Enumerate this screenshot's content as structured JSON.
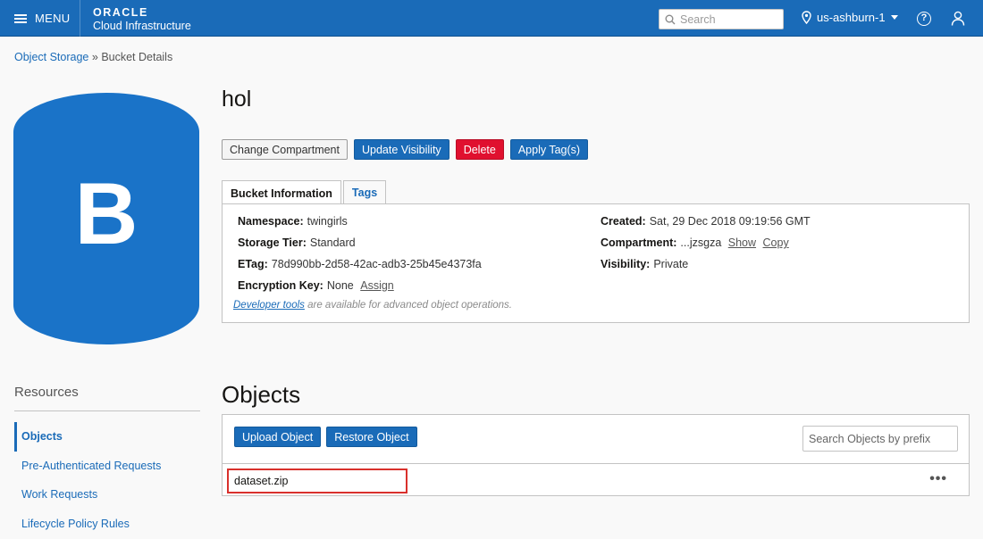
{
  "topbar": {
    "menu_label": "MENU",
    "brand": "ORACLE",
    "brand_sub": "Cloud Infrastructure",
    "search_placeholder": "Search",
    "region": "us-ashburn-1",
    "help_symbol": "?"
  },
  "breadcrumb": {
    "root": "Object Storage",
    "separator": "»",
    "current": "Bucket Details"
  },
  "bucket": {
    "icon_letter": "B",
    "name": "hol",
    "actions": [
      "Change Compartment",
      "Update Visibility",
      "Delete",
      "Apply Tag(s)"
    ]
  },
  "tabs": [
    "Bucket Information",
    "Tags"
  ],
  "info": {
    "namespace": {
      "label": "Namespace:",
      "value": "twingirls"
    },
    "storage_tier": {
      "label": "Storage Tier:",
      "value": "Standard"
    },
    "etag": {
      "label": "ETag:",
      "value": "78d990bb-2d58-42ac-adb3-25b45e4373fa"
    },
    "encryption": {
      "label": "Encryption Key:",
      "value": "None",
      "link": "Assign"
    },
    "created": {
      "label": "Created:",
      "value": "Sat, 29 Dec 2018 09:19:56 GMT"
    },
    "compartment": {
      "label": "Compartment:",
      "value": "...jzsgza",
      "show": "Show",
      "copy": "Copy"
    },
    "visibility": {
      "label": "Visibility:",
      "value": "Private"
    },
    "dev_link": "Developer tools",
    "dev_text": "are available for advanced object operations."
  },
  "resources": {
    "heading": "Resources",
    "items": [
      "Objects",
      "Pre-Authenticated Requests",
      "Work Requests",
      "Lifecycle Policy Rules"
    ]
  },
  "objects": {
    "title": "Objects",
    "upload_label": "Upload Object",
    "restore_label": "Restore Object",
    "search_placeholder": "Search Objects by prefix",
    "rows": [
      {
        "name": "dataset.zip",
        "menu": "•••"
      }
    ]
  },
  "colors": {
    "brand_blue": "#1a6bb8",
    "bucket_blue": "#1a73c8",
    "danger_red": "#e0102f",
    "highlight_red": "#d9302c"
  }
}
